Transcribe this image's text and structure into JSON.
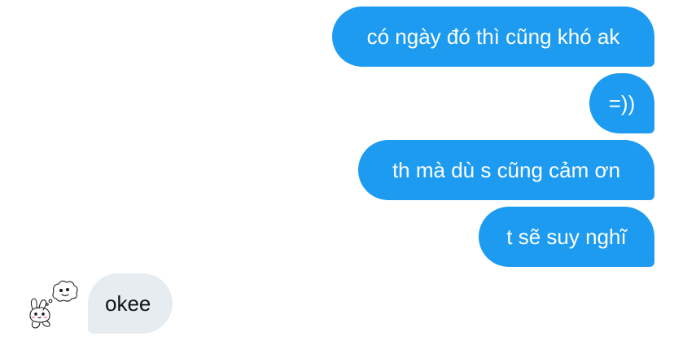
{
  "conversation": {
    "messages": [
      {
        "direction": "outgoing",
        "text": "có ngày đó thì cũng khó ak"
      },
      {
        "direction": "outgoing",
        "text": "=))"
      },
      {
        "direction": "outgoing",
        "text": "th mà dù s cũng cảm ơn"
      },
      {
        "direction": "outgoing",
        "text": "t sẽ suy nghĩ"
      },
      {
        "direction": "incoming",
        "text": "okee"
      }
    ],
    "incoming_avatar_icon": "bunny-doodle-avatar-icon"
  },
  "colors": {
    "outgoing_bubble": "#1d9bf0",
    "outgoing_text": "#ffffff",
    "incoming_bubble": "#e7ecf0",
    "incoming_text": "#0f1419",
    "background": "#ffffff"
  }
}
